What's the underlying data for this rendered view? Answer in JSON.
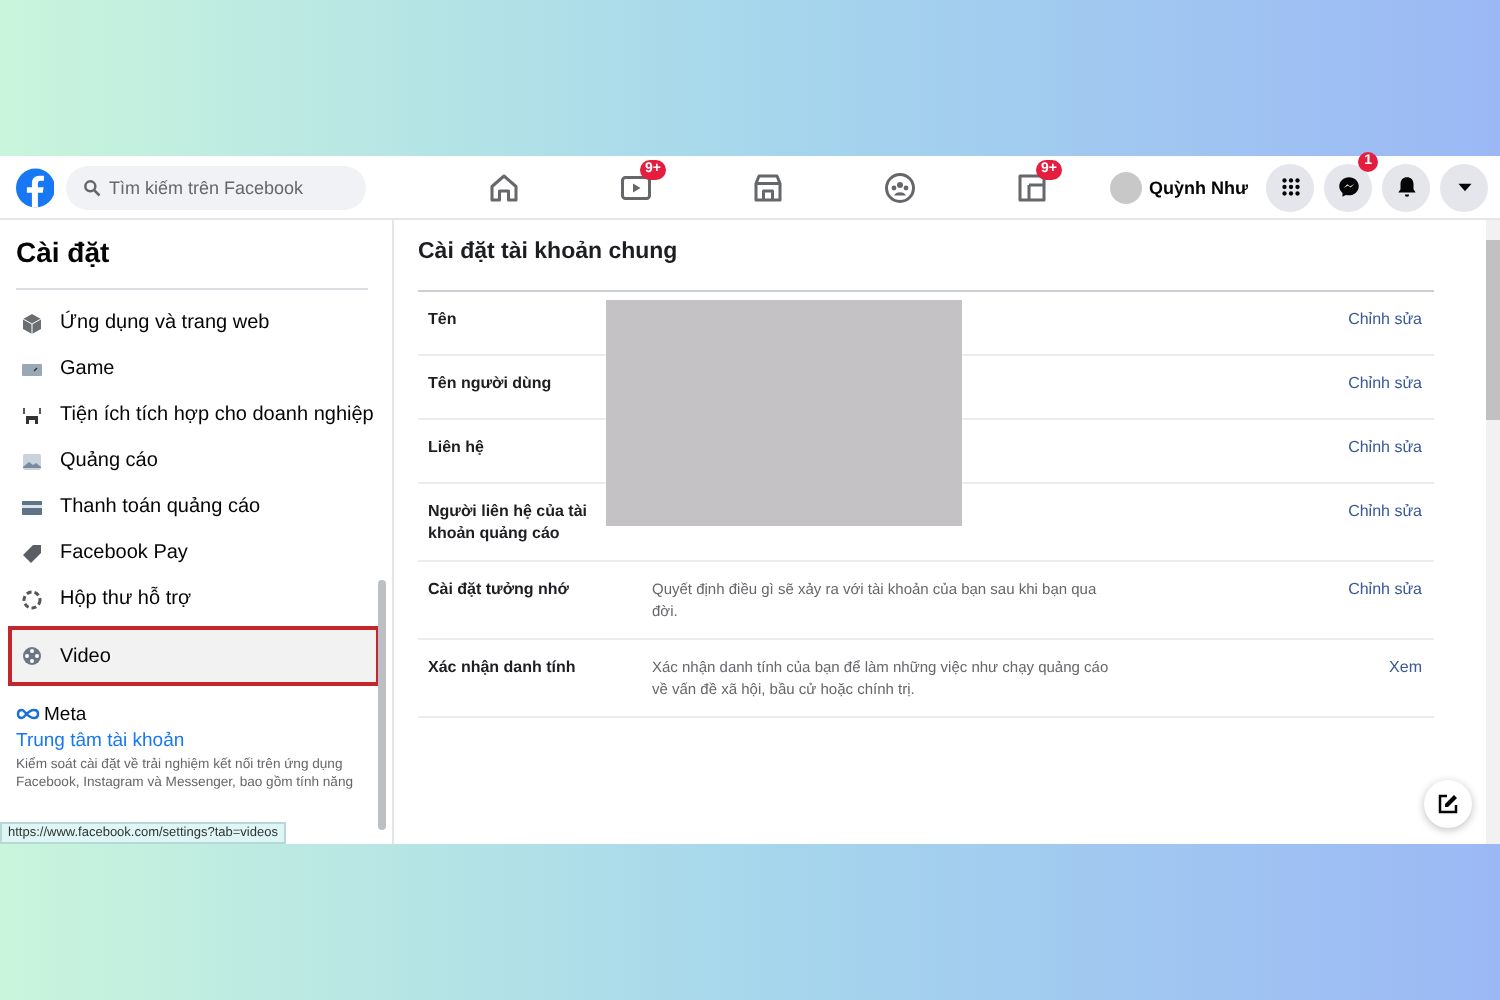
{
  "topbar": {
    "search": {
      "placeholder": "Tìm kiếm trên Facebook"
    },
    "nav": [
      {
        "kind": "home",
        "selected": false
      },
      {
        "kind": "video",
        "badge": "9+",
        "selected": false
      },
      {
        "kind": "store",
        "selected": false
      },
      {
        "kind": "groups",
        "selected": false
      },
      {
        "kind": "gaming",
        "badge": "9+",
        "selected": false
      }
    ],
    "profile": {
      "name": "Quỳnh Như"
    },
    "actions": [
      {
        "kind": "menu"
      },
      {
        "kind": "messenger",
        "badge": "1"
      },
      {
        "kind": "bell"
      },
      {
        "kind": "caret"
      }
    ]
  },
  "sidebar": {
    "title": "Cài đặt",
    "items": [
      {
        "kind": "apps",
        "label": "Ứng dụng và trang web",
        "highlighted": false
      },
      {
        "kind": "game",
        "label": "Game",
        "highlighted": false
      },
      {
        "kind": "business",
        "label": "Tiện ích tích hợp cho doanh nghiệp",
        "highlighted": false
      },
      {
        "kind": "ads",
        "label": "Quảng cáo",
        "highlighted": false
      },
      {
        "kind": "payment",
        "label": "Thanh toán quảng cáo",
        "highlighted": false
      },
      {
        "kind": "pay",
        "label": "Facebook Pay",
        "highlighted": false
      },
      {
        "kind": "support",
        "label": "Hộp thư hỗ trợ",
        "highlighted": false
      },
      {
        "kind": "video",
        "label": "Video",
        "highlighted": true
      }
    ],
    "brand": "Meta",
    "account_center": "Trung tâm tài khoản",
    "description": "Kiểm soát cài đặt về trải nghiệm kết nối trên ứng dụng Facebook, Instagram và Messenger, bao gồm tính năng"
  },
  "main": {
    "title": "Cài đặt tài khoản chung",
    "rows": [
      {
        "label": "Tên",
        "action": "Chỉnh sửa"
      },
      {
        "label": "Tên người dùng",
        "action": "Chỉnh sửa"
      },
      {
        "label": "Liên hệ",
        "action": "Chỉnh sửa"
      },
      {
        "label": "Người liên hệ của tài khoản quảng cáo",
        "action": "Chỉnh sửa"
      },
      {
        "label": "Cài đặt tưởng nhớ",
        "value": "Quyết định điều gì sẽ xảy ra với tài khoản của bạn sau khi bạn qua đời.",
        "action": "Chỉnh sửa"
      },
      {
        "label": "Xác nhận danh tính",
        "value": "Xác nhận danh tính của bạn để làm những việc như chạy quảng cáo về vấn đề xã hội, bầu cử hoặc chính trị.",
        "action": "Xem"
      }
    ]
  },
  "status_url": "https://www.facebook.com/settings?tab=videos"
}
